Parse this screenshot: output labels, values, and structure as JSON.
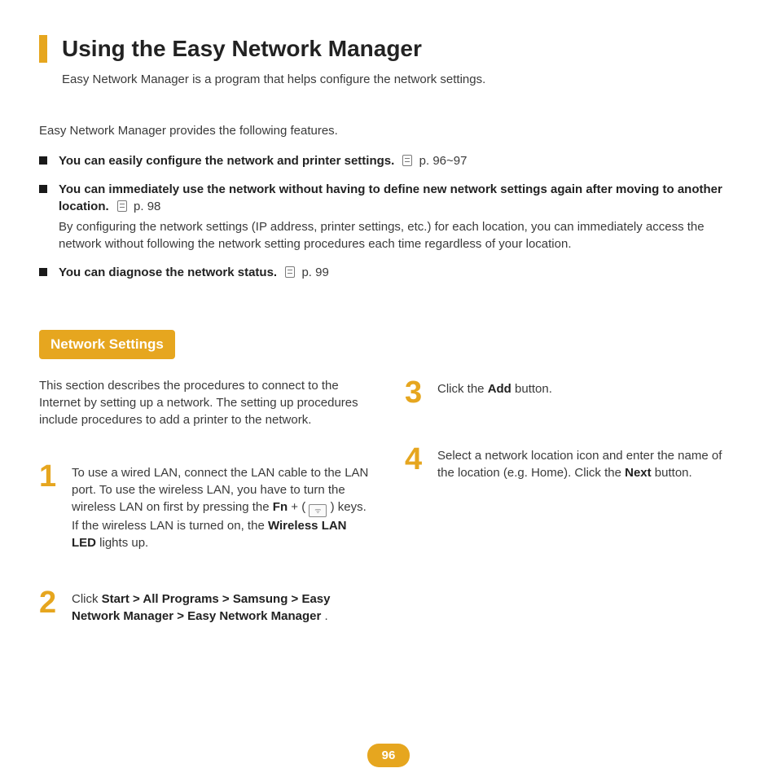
{
  "page": {
    "title": "Using the Easy Network Manager",
    "subtitle": "Easy Network Manager is a program that helps configure the network settings.",
    "intro": "Easy Network Manager provides the following features.",
    "features": [
      {
        "head": "You can easily configure the network and printer settings.",
        "page_ref": "p. 96~97",
        "desc": ""
      },
      {
        "head": "You can immediately use the network without having to define new network settings again after moving to another location.",
        "page_ref": "p. 98",
        "desc": "By configuring the network settings (IP address, printer settings, etc.) for each location, you can immediately access the network without following the network setting procedures each time regardless of your location."
      },
      {
        "head": "You can diagnose the network status.",
        "page_ref": "p. 99",
        "desc": ""
      }
    ],
    "section_title": "Network Settings",
    "section_intro": "This section describes the procedures to connect to the Internet by setting up a network. The setting up procedures include procedures to add a printer to the network.",
    "steps": {
      "left": [
        {
          "num": "1",
          "pre": "To use a wired LAN, connect the LAN cable to the LAN port. To use the wireless LAN, you have to turn the wireless LAN on first by pressing the  ",
          "bold1": "Fn",
          "mid": " + (",
          "post": ") keys. If the wireless LAN is turned on, the ",
          "bold2": "Wireless LAN LED",
          "tail": " lights up."
        },
        {
          "num": "2",
          "pre": "Click ",
          "bold1": "Start > All Programs > Samsung > Easy Network Manager > Easy Network Manager",
          "tail": "."
        }
      ],
      "right": [
        {
          "num": "3",
          "pre": "Click the ",
          "bold1": "Add",
          "tail": " button."
        },
        {
          "num": "4",
          "pre": "Select a network location icon and enter the name of the location (e.g. Home). Click the ",
          "bold1": "Next",
          "tail": " button."
        }
      ]
    },
    "page_number": "96"
  }
}
